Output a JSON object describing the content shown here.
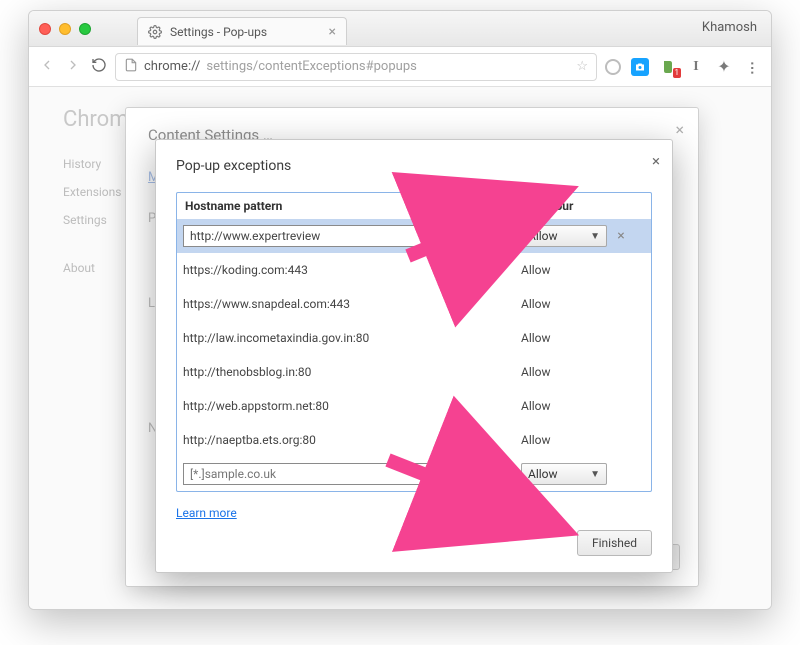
{
  "macos": {
    "profile_name": "Khamosh"
  },
  "tab": {
    "title": "Settings - Pop-ups"
  },
  "address_bar": {
    "scheme_host": "chrome://",
    "path": "settings/contentExceptions#popups"
  },
  "ext_badge": "1",
  "ext_roman": "I",
  "background_page": {
    "brand": "Chrom",
    "sidebar": [
      "History",
      "Extensions",
      "Settings",
      "About"
    ]
  },
  "content_settings_modal": {
    "title": "Content Settings …",
    "link_manage": "M",
    "section_popups": "Pop-",
    "section_local": "Loca",
    "section_notif": "Noti",
    "finished_label": "Finished"
  },
  "popup_exceptions": {
    "title": "Pop-up exceptions",
    "col_host": "Hostname pattern",
    "col_behaviour": "Behaviour",
    "editing_value": "http://www.expertreview",
    "editing_behaviour": "Allow",
    "rows": [
      {
        "host": "https://koding.com:443",
        "behaviour": "Allow"
      },
      {
        "host": "https://www.snapdeal.com:443",
        "behaviour": "Allow"
      },
      {
        "host": "http://law.incometaxindia.gov.in:80",
        "behaviour": "Allow"
      },
      {
        "host": "http://thenobsblog.in:80",
        "behaviour": "Allow"
      },
      {
        "host": "http://web.appstorm.net:80",
        "behaviour": "Allow"
      },
      {
        "host": "http://naeptba.ets.org:80",
        "behaviour": "Allow"
      }
    ],
    "new_placeholder": "[*.]sample.co.uk",
    "new_behaviour": "Allow",
    "learn_more": "Learn more",
    "finished_label": "Finished"
  }
}
